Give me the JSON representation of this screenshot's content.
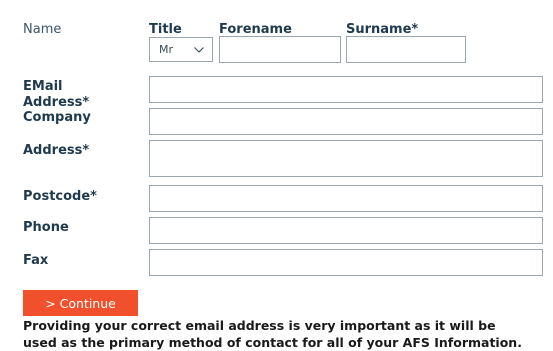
{
  "form": {
    "name_label": "Name",
    "title_label": "Title",
    "forename_label": "Forename",
    "surname_label": "Surname*",
    "title_select": {
      "value": "Mr"
    },
    "email_label_line1": "EMail",
    "email_label_line2": "Address*",
    "company_label": "Company",
    "address_label": "Address*",
    "postcode_label": "Postcode*",
    "phone_label": "Phone",
    "fax_label": "Fax",
    "continue_label": "> Continue",
    "notice_line1": "Providing your correct email address is very important as it will be",
    "notice_line2": "used as the primary method of contact for all of your AFS Information."
  },
  "colors": {
    "button_bg": "#f0512c",
    "label_text": "#1f3a4d",
    "field_border": "#9aa7b0"
  }
}
